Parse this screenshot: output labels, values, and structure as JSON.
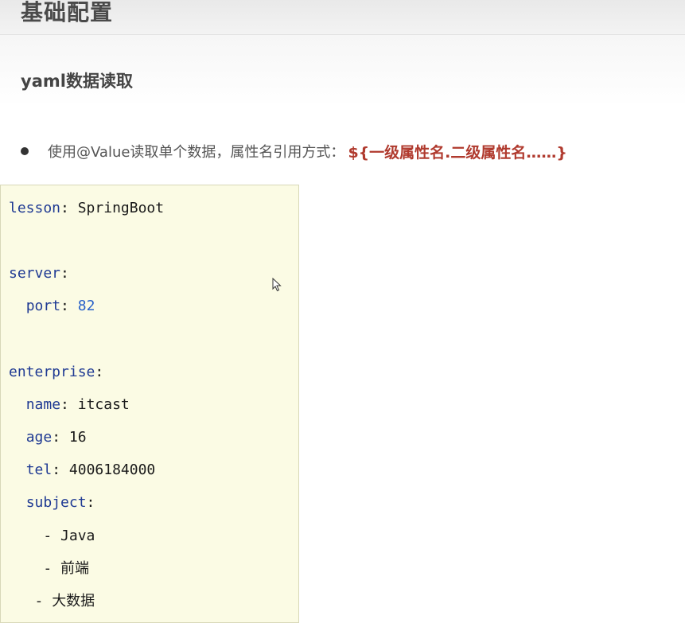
{
  "page": {
    "title": "基础配置",
    "section_title": "yaml数据读取",
    "bullet": {
      "text": "使用@Value读取单个数据，属性名引用方式：",
      "code": "${一级属性名.二级属性名……}"
    }
  },
  "yaml": {
    "lesson_key": "lesson",
    "lesson_value": "SpringBoot",
    "server_key": "server",
    "port_key": "port",
    "port_value": "82",
    "enterprise_key": "enterprise",
    "name_key": "name",
    "name_value": "itcast",
    "age_key": "age",
    "age_value": "16",
    "tel_key": "tel",
    "tel_value": "4006184000",
    "subject_key": "subject",
    "subjects": [
      "Java",
      "前端",
      "大数据"
    ]
  },
  "colors": {
    "code_background": "#fbfbe4",
    "key": "#1f3a93",
    "number": "#2962c9",
    "highlight": "#b03a2e"
  },
  "icons": {
    "cursor": "mouse-pointer-icon"
  }
}
